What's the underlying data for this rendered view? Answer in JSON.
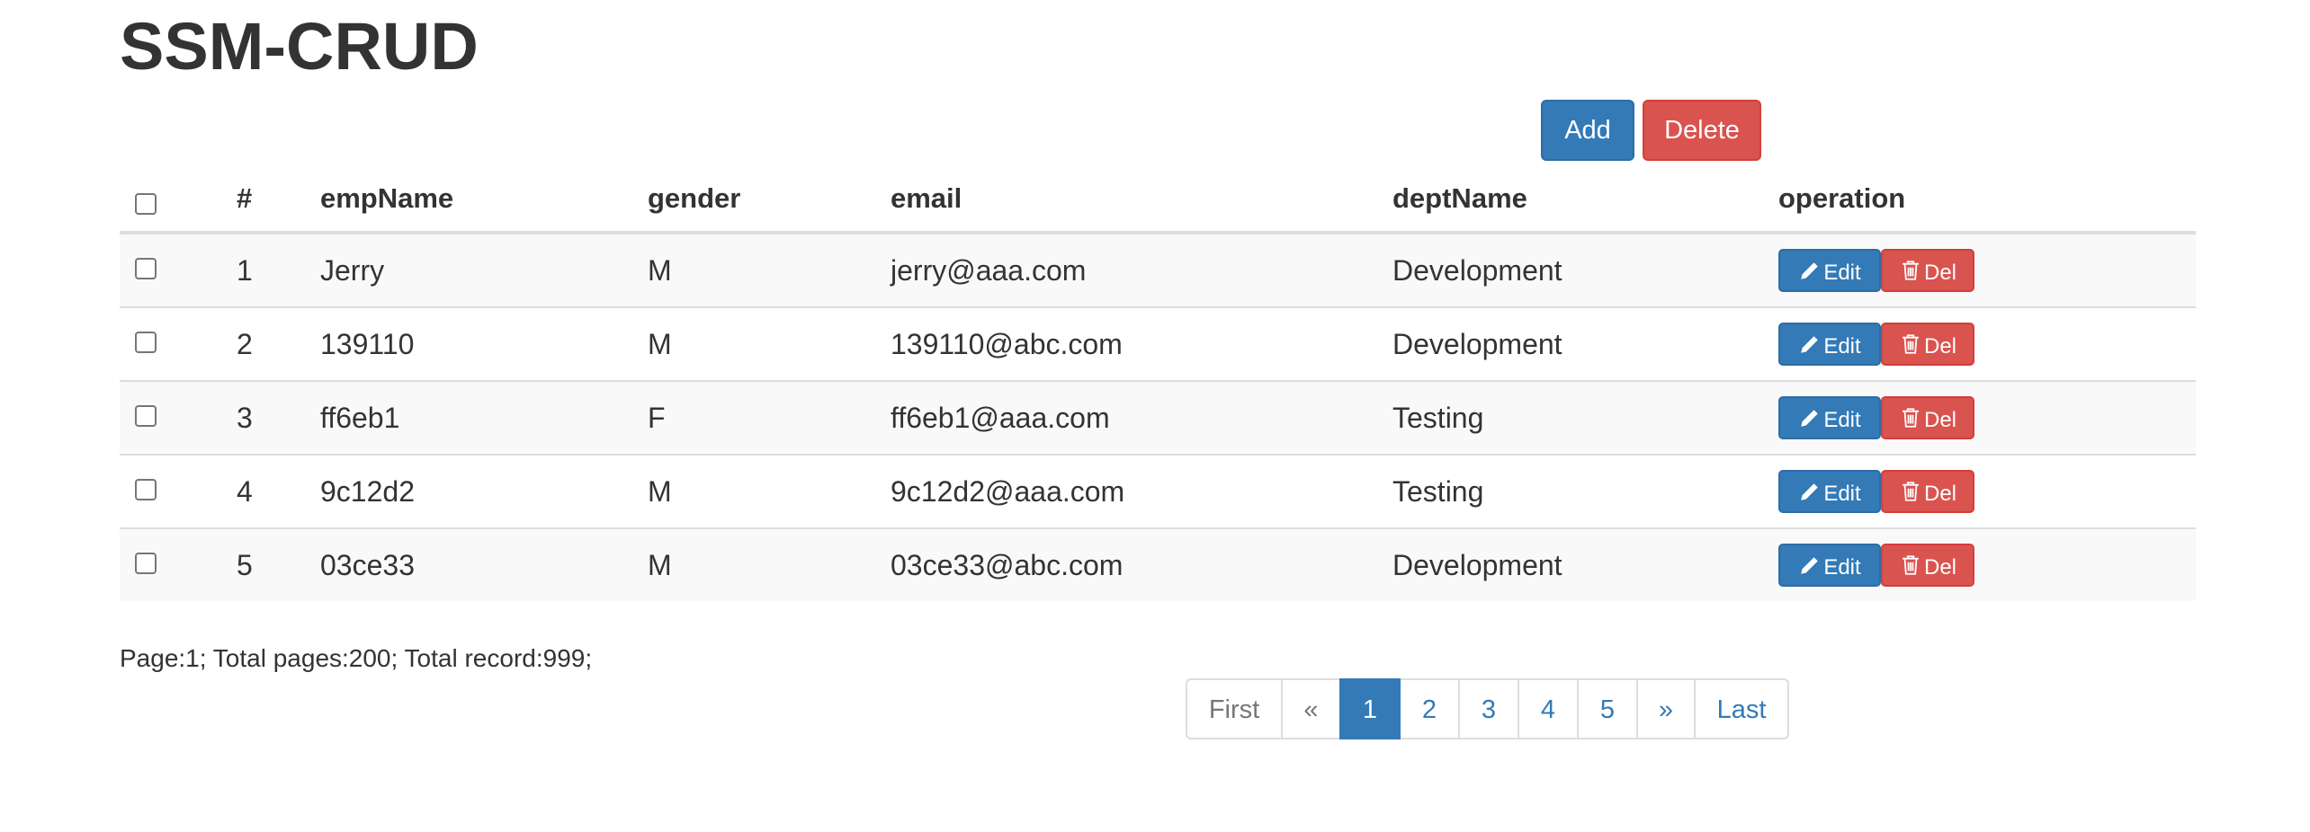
{
  "title": "SSM-CRUD",
  "toolbar": {
    "add_label": "Add",
    "delete_label": "Delete"
  },
  "table": {
    "columns": [
      "#",
      "empName",
      "gender",
      "email",
      "deptName",
      "operation"
    ],
    "rows": [
      {
        "id": "1",
        "empName": "Jerry",
        "gender": "M",
        "email": "jerry@aaa.com",
        "deptName": "Development"
      },
      {
        "id": "2",
        "empName": "139110",
        "gender": "M",
        "email": "139110@abc.com",
        "deptName": "Development"
      },
      {
        "id": "3",
        "empName": "ff6eb1",
        "gender": "F",
        "email": "ff6eb1@aaa.com",
        "deptName": "Testing"
      },
      {
        "id": "4",
        "empName": "9c12d2",
        "gender": "M",
        "email": "9c12d2@aaa.com",
        "deptName": "Testing"
      },
      {
        "id": "5",
        "empName": "03ce33",
        "gender": "M",
        "email": "03ce33@abc.com",
        "deptName": "Development"
      }
    ],
    "row_actions": {
      "edit_label": "Edit",
      "edit_icon": "pencil-icon",
      "del_label": "Del",
      "del_icon": "trash-icon"
    }
  },
  "page_info": "Page:1; Total pages:200; Total record:999;",
  "pagination": {
    "first": "First",
    "prev": "«",
    "pages": [
      "1",
      "2",
      "3",
      "4",
      "5"
    ],
    "current": "1",
    "next": "»",
    "last": "Last"
  },
  "colors": {
    "primary": "#337ab7",
    "danger": "#d9534f",
    "stripe": "#f9f9f9",
    "border": "#dddddd",
    "text": "#333333"
  }
}
